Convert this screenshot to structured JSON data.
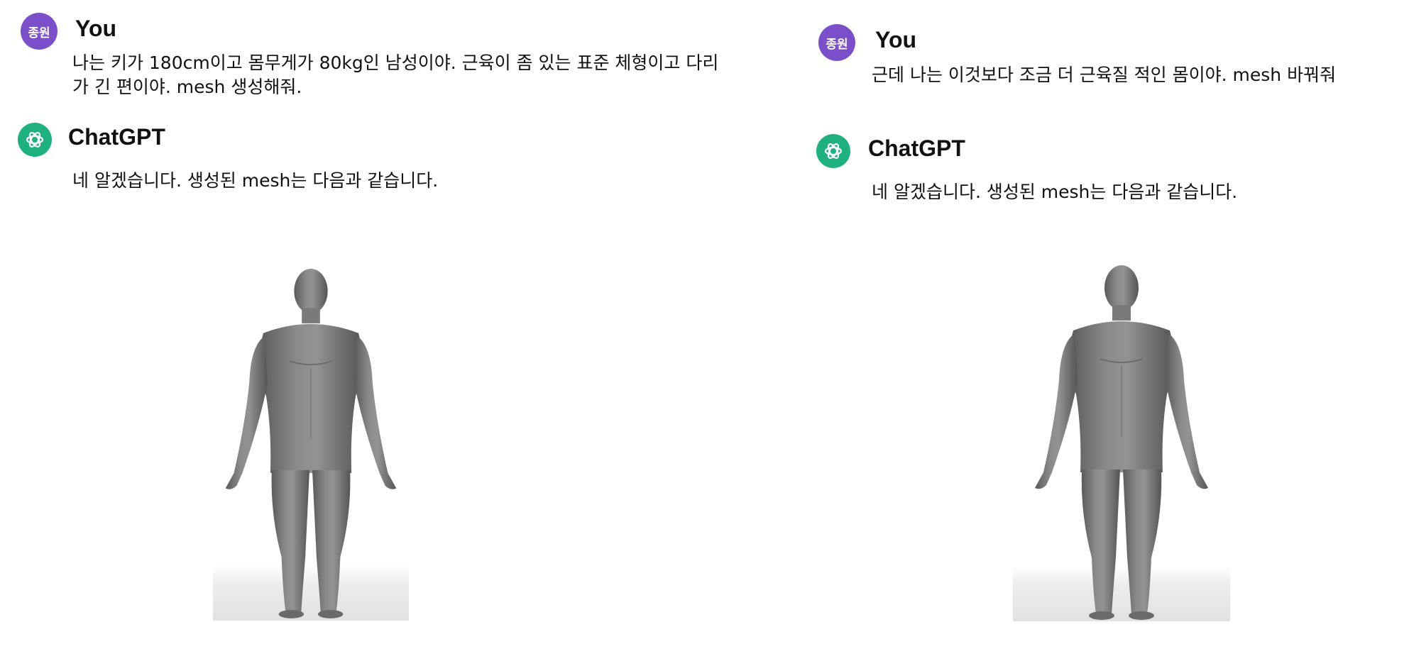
{
  "left": {
    "user_avatar": "종원",
    "user_name": "You",
    "user_message": "나는 키가 180cm이고 몸무게가 80kg인 남성이야. 근육이 좀 있는 표준 체형이고 다리가 긴 편이야. mesh 생성해줘.",
    "bot_name": "ChatGPT",
    "bot_message": "네 알겠습니다. 생성된 mesh는 다음과 같습니다.",
    "bot_avatar_icon": "openai-logo-icon",
    "mesh_icon": "human-mesh-figure"
  },
  "right": {
    "user_avatar": "종원",
    "user_name": "You",
    "user_message": "근데 나는 이것보다 조금 더 근육질 적인 몸이야. mesh 바꿔줘",
    "bot_name": "ChatGPT",
    "bot_message": "네 알겠습니다. 생성된 mesh는 다음과 같습니다.",
    "bot_avatar_icon": "openai-logo-icon",
    "mesh_icon": "human-mesh-figure"
  },
  "colors": {
    "user_avatar": "#7b4fc9",
    "bot_avatar": "#1fb07f",
    "mesh": "#7a7a7a"
  }
}
